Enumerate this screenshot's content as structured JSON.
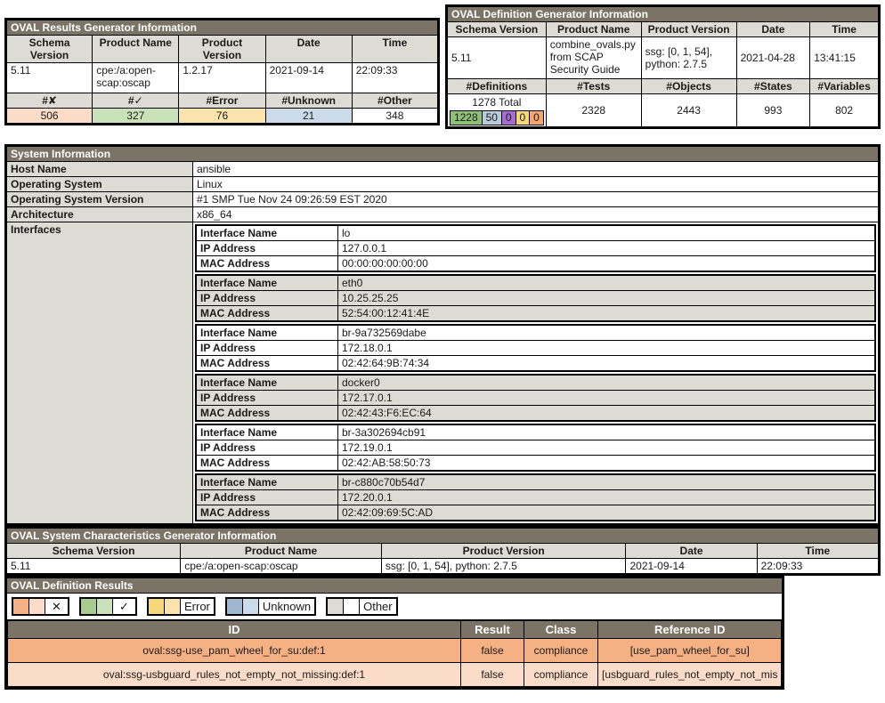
{
  "results_generator": {
    "title": "OVAL Results Generator Information",
    "headers": [
      "Schema Version",
      "Product Name",
      "Product Version",
      "Date",
      "Time"
    ],
    "values": [
      "5.11",
      "cpe:/a:open-scap:oscap",
      "1.2.17",
      "2021-09-14",
      "22:09:33"
    ],
    "count_headers": [
      "#✘",
      "#✓",
      "#Error",
      "#Unknown",
      "#Other"
    ],
    "count_values": [
      "506",
      "327",
      "76",
      "21",
      "348"
    ]
  },
  "definition_generator": {
    "title": "OVAL Definition Generator Information",
    "headers": [
      "Schema Version",
      "Product Name",
      "Product Version",
      "Date",
      "Time"
    ],
    "values": [
      "5.11",
      "combine_ovals.py from SCAP Security Guide",
      "ssg: [0, 1, 54], python: 2.7.5",
      "2021-04-28",
      "13:41:15"
    ],
    "count_headers": [
      "#Definitions",
      "#Tests",
      "#Objects",
      "#States",
      "#Variables"
    ],
    "definitions_total": "1278 Total",
    "definitions_breakdown": [
      "1228",
      "50",
      "0",
      "0",
      "0"
    ],
    "count_values": [
      "2328",
      "2443",
      "993",
      "802"
    ]
  },
  "system_information": {
    "title": "System Information",
    "rows": [
      {
        "label": "Host Name",
        "value": "ansible"
      },
      {
        "label": "Operating System",
        "value": "Linux"
      },
      {
        "label": "Operating System Version",
        "value": "#1 SMP Tue Nov 24 09:26:59 EST 2020"
      },
      {
        "label": "Architecture",
        "value": "x86_64"
      }
    ],
    "interfaces_label": "Interfaces",
    "interface_keys": [
      "Interface Name",
      "IP Address",
      "MAC Address"
    ],
    "interfaces": [
      {
        "name": "lo",
        "ip": "127.0.0.1",
        "mac": "00:00:00:00:00:00"
      },
      {
        "name": "eth0",
        "ip": "10.25.25.25",
        "mac": "52:54:00:12:41:4E"
      },
      {
        "name": "br-9a732569dabe",
        "ip": "172.18.0.1",
        "mac": "02:42:64:9B:74:34"
      },
      {
        "name": "docker0",
        "ip": "172.17.0.1",
        "mac": "02:42:43:F6:EC:64"
      },
      {
        "name": "br-3a302694cb91",
        "ip": "172.19.0.1",
        "mac": "02:42:AB:58:50:73"
      },
      {
        "name": "br-c880c70b54d7",
        "ip": "172.20.0.1",
        "mac": "02:42:09:69:5C:AD"
      }
    ]
  },
  "syschar_generator": {
    "title": "OVAL System Characteristics Generator Information",
    "headers": [
      "Schema Version",
      "Product Name",
      "Product Version",
      "Date",
      "Time"
    ],
    "values": [
      "5.11",
      "cpe:/a:open-scap:oscap",
      "ssg: [0, 1, 54], python: 2.7.5",
      "2021-09-14",
      "22:09:33"
    ]
  },
  "definition_results": {
    "title": "OVAL Definition Results",
    "legend": [
      {
        "name": "fail",
        "label": "✕"
      },
      {
        "name": "pass",
        "label": "✓"
      },
      {
        "name": "error",
        "label": "Error"
      },
      {
        "name": "unknown",
        "label": "Unknown"
      },
      {
        "name": "other",
        "label": "Other"
      }
    ],
    "headers": [
      "ID",
      "Result",
      "Class",
      "Reference ID"
    ],
    "rows": [
      {
        "id": "oval:ssg-use_pam_wheel_for_su:def:1",
        "result": "false",
        "class": "compliance",
        "reference_id": "[use_pam_wheel_for_su]"
      },
      {
        "id": "oval:ssg-usbguard_rules_not_empty_not_missing:def:1",
        "result": "false",
        "class": "compliance",
        "reference_id": "[usbguard_rules_not_empty_not_mis"
      }
    ]
  },
  "colors": {
    "header_bar": "#7b7365",
    "col_header": "#dcdcd4",
    "fail_dark": "#f5b183",
    "fail_light": "#fbdcc8",
    "pass_dark": "#a8cc90",
    "pass_light": "#c9e2b9",
    "error_dark": "#f6d77a",
    "error_light": "#fbe3ad",
    "unknown_dark": "#9fb8d0",
    "unknown_light": "#ccdbea",
    "other_dark": "#dcdcd4",
    "other_light": "#ffffff"
  }
}
